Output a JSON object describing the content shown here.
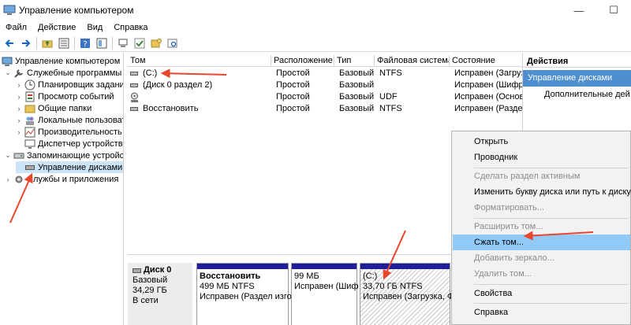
{
  "window": {
    "title": "Управление компьютером",
    "minimize": "—",
    "maximize": "☐"
  },
  "menu": [
    "Файл",
    "Действие",
    "Вид",
    "Справка"
  ],
  "toolbar_icons": [
    "back-icon",
    "forward-icon",
    "up-folder-icon",
    "properties-icon",
    "help-icon",
    "view-icon",
    "wizard-icon",
    "check-icon",
    "folder-lock-icon",
    "search-icon"
  ],
  "tree": [
    {
      "label": "Управление компьютером (л",
      "depth": 0,
      "chevron": "",
      "icon": "computer-icon"
    },
    {
      "label": "Служебные программы",
      "depth": 1,
      "chevron": "⌄",
      "icon": "tools-icon"
    },
    {
      "label": "Планировщик задани",
      "depth": 2,
      "chevron": "›",
      "icon": "clock-icon"
    },
    {
      "label": "Просмотр событий",
      "depth": 2,
      "chevron": "›",
      "icon": "event-log-icon"
    },
    {
      "label": "Общие папки",
      "depth": 2,
      "chevron": "›",
      "icon": "shared-folder-icon"
    },
    {
      "label": "Локальные пользовате",
      "depth": 2,
      "chevron": "›",
      "icon": "users-icon"
    },
    {
      "label": "Производительность",
      "depth": 2,
      "chevron": "›",
      "icon": "performance-icon"
    },
    {
      "label": "Диспетчер устройств",
      "depth": 2,
      "chevron": "",
      "icon": "device-manager-icon"
    },
    {
      "label": "Запоминающие устройст",
      "depth": 1,
      "chevron": "⌄",
      "icon": "storage-icon"
    },
    {
      "label": "Управление дисками",
      "depth": 2,
      "chevron": "",
      "icon": "disk-icon",
      "selected": true
    },
    {
      "label": "Службы и приложения",
      "depth": 1,
      "chevron": "›",
      "icon": "services-icon"
    }
  ],
  "volumes": {
    "headers": [
      "Том",
      "Расположение",
      "Тип",
      "Файловая система",
      "Состояние"
    ],
    "rows": [
      [
        "(C:)",
        "Простой",
        "Базовый",
        "NTFS",
        "Исправен (Загрузч"
      ],
      [
        "(Диск 0 раздел 2)",
        "Простой",
        "Базовый",
        "",
        "Исправен (Шифр"
      ],
      [
        "",
        "Простой",
        "Базовый",
        "UDF",
        "Исправен (Основ"
      ],
      [
        "Восстановить",
        "Простой",
        "Базовый",
        "NTFS",
        "Исправен (Разде"
      ]
    ]
  },
  "disk": {
    "name": "Диск 0",
    "type": "Базовый",
    "size": "34,29 ГБ",
    "status": "В сети",
    "partitions": [
      {
        "title": "Восстановить",
        "line2": "499 МБ NTFS",
        "line3": "Исправен (Раздел изго"
      },
      {
        "title": "",
        "line2": "99 МБ",
        "line3": "Исправен (Шиф"
      },
      {
        "title": "(C:)",
        "line2": "33,70 ГБ NTFS",
        "line3": "Исправен (Загрузка, Фа"
      }
    ]
  },
  "actions": {
    "header": "Действия",
    "section": "Управление дисками",
    "more": "Дополнительные дей..."
  },
  "context_menu": [
    {
      "label": "Открыть",
      "disabled": false
    },
    {
      "label": "Проводник",
      "disabled": false
    },
    {
      "sep": true
    },
    {
      "label": "Сделать раздел активным",
      "disabled": true
    },
    {
      "label": "Изменить букву диска или путь к диску...",
      "disabled": false
    },
    {
      "label": "Форматировать...",
      "disabled": true
    },
    {
      "sep": true
    },
    {
      "label": "Расширить том...",
      "disabled": true
    },
    {
      "label": "Сжать том...",
      "disabled": false,
      "highlighted": true
    },
    {
      "label": "Добавить зеркало...",
      "disabled": true
    },
    {
      "label": "Удалить том...",
      "disabled": true
    },
    {
      "sep": true
    },
    {
      "label": "Свойства",
      "disabled": false
    },
    {
      "sep": true
    },
    {
      "label": "Справка",
      "disabled": false
    }
  ],
  "colors": {
    "accent_bar": "#1f1f9e",
    "actions_highlight": "#4f8fd0",
    "menu_highlight": "#91c9f7",
    "annotation_arrow": "#e8472e"
  }
}
